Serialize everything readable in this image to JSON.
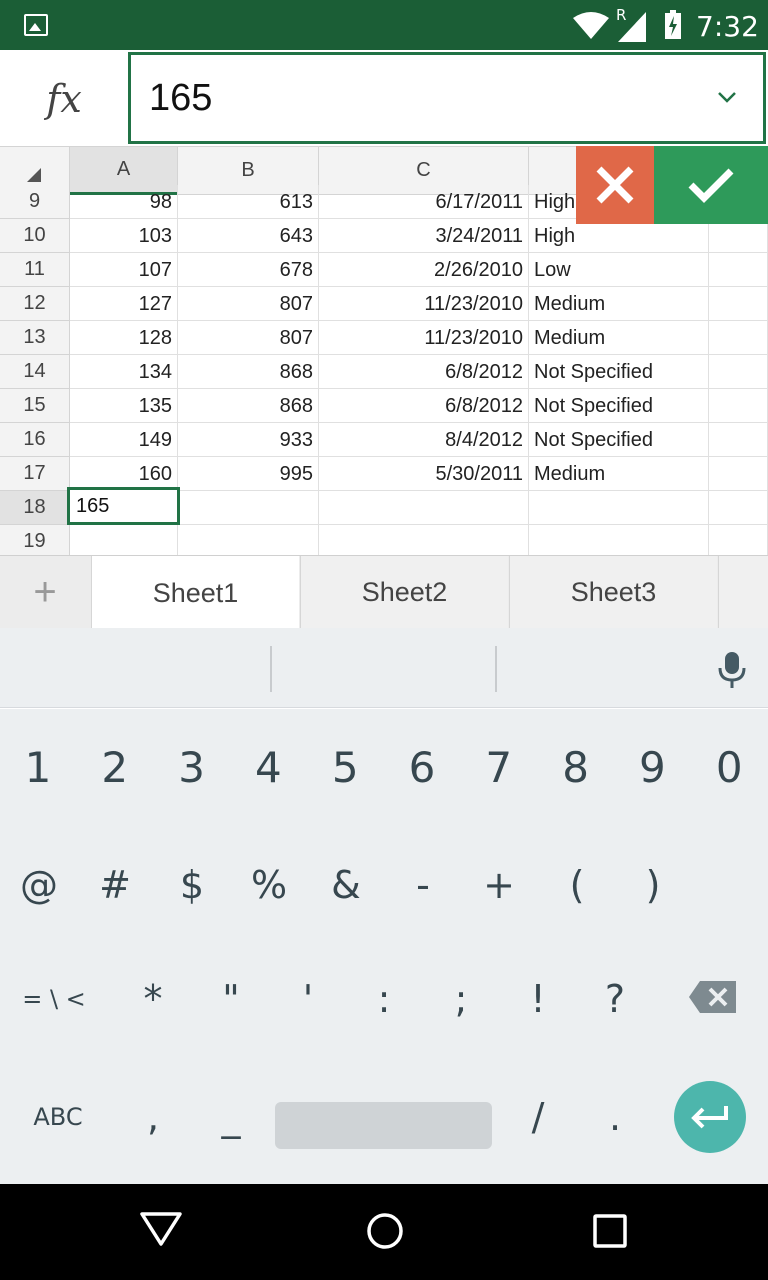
{
  "status_bar": {
    "time": "7:32",
    "signal_label": "R"
  },
  "formula_bar": {
    "fx_label": "fx",
    "value": "165"
  },
  "columns": [
    "A",
    "B",
    "C"
  ],
  "rows": [
    {
      "n": "9",
      "a": "98",
      "b": "613",
      "c": "6/17/2011",
      "d": "High"
    },
    {
      "n": "10",
      "a": "103",
      "b": "643",
      "c": "3/24/2011",
      "d": "High"
    },
    {
      "n": "11",
      "a": "107",
      "b": "678",
      "c": "2/26/2010",
      "d": "Low"
    },
    {
      "n": "12",
      "a": "127",
      "b": "807",
      "c": "11/23/2010",
      "d": "Medium"
    },
    {
      "n": "13",
      "a": "128",
      "b": "807",
      "c": "11/23/2010",
      "d": "Medium"
    },
    {
      "n": "14",
      "a": "134",
      "b": "868",
      "c": "6/8/2012",
      "d": "Not Specified"
    },
    {
      "n": "15",
      "a": "135",
      "b": "868",
      "c": "6/8/2012",
      "d": "Not Specified"
    },
    {
      "n": "16",
      "a": "149",
      "b": "933",
      "c": "8/4/2012",
      "d": "Not Specified"
    },
    {
      "n": "17",
      "a": "160",
      "b": "995",
      "c": "5/30/2011",
      "d": "Medium"
    },
    {
      "n": "18",
      "a": "",
      "b": "",
      "c": "",
      "d": ""
    },
    {
      "n": "19",
      "a": "",
      "b": "",
      "c": "",
      "d": ""
    }
  ],
  "active_cell": {
    "row": "18",
    "value": "165"
  },
  "sheet_tabs": {
    "add": "+",
    "tabs": [
      "Sheet1",
      "Sheet2",
      "Sheet3"
    ],
    "active": "Sheet1"
  },
  "keyboard": {
    "row1": [
      "1",
      "2",
      "3",
      "4",
      "5",
      "6",
      "7",
      "8",
      "9",
      "0"
    ],
    "row2": [
      "@",
      "#",
      "$",
      "%",
      "&",
      "-",
      "+",
      "(",
      ")"
    ],
    "row3": [
      "= \\ <",
      "*",
      "\"",
      "'",
      ":",
      ";",
      "!",
      "?"
    ],
    "row4": [
      "ABC",
      ",",
      "_",
      "/",
      "."
    ]
  },
  "colors": {
    "accent": "#217346",
    "status_bar": "#1b5e36",
    "cancel": "#e06848",
    "confirm": "#2e9a5a",
    "enter": "#4db6ac"
  }
}
